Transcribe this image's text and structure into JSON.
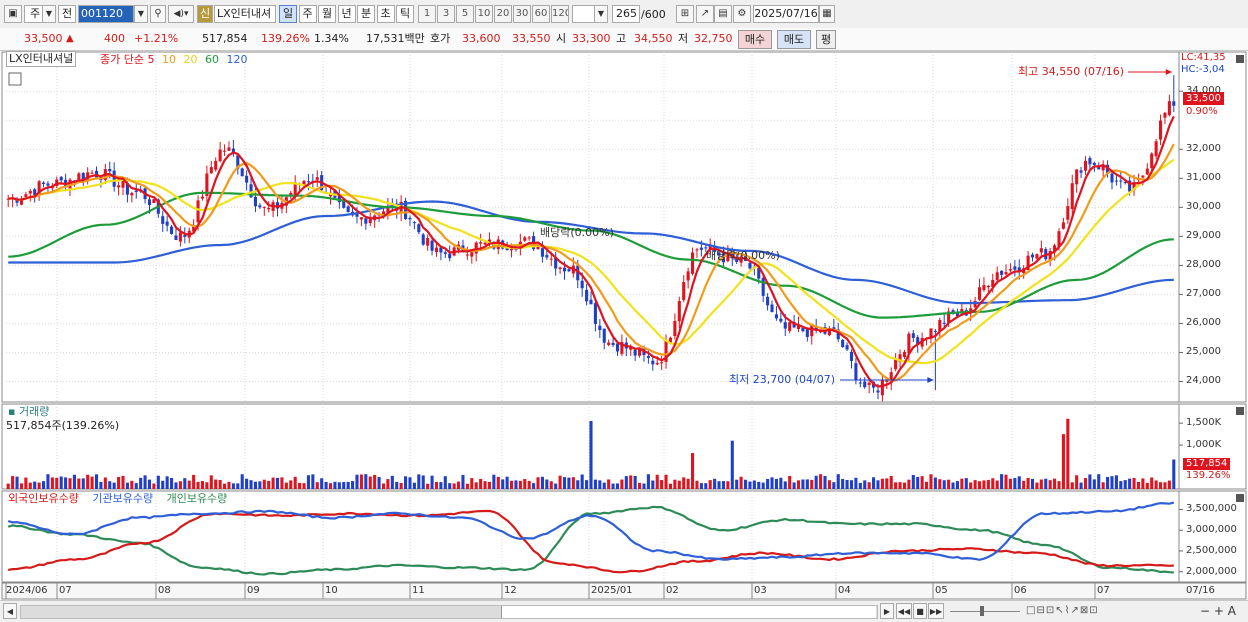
{
  "toolbar": {
    "market_label": "주",
    "prev_label": "전",
    "code_value": "001120",
    "new_badge": "신",
    "stock_name": "LX인터내셔",
    "periods": [
      "일",
      "주",
      "월",
      "년",
      "분",
      "초",
      "틱"
    ],
    "active_period": "일",
    "intervals": [
      "1",
      "3",
      "5",
      "10",
      "20",
      "30",
      "60",
      "120"
    ],
    "count_value": "265",
    "count_total": "/600",
    "date_value": "2025/07/16"
  },
  "quote": {
    "price": "33,500",
    "change_arrow": "▲",
    "change": "400",
    "change_pct": "+1.21%",
    "volume": "517,854",
    "volume_ratio": "139.26%",
    "turnover_pct": "1.34%",
    "trade_value": "17,531백만",
    "ask_label": "호가",
    "ask": "33,600",
    "bid": "33,550",
    "open_label": "시",
    "open": "33,300",
    "high_label": "고",
    "high": "34,550",
    "low_label": "저",
    "low": "32,750",
    "buy_label": "매수",
    "sell_label": "매도",
    "eval_label": "평"
  },
  "price_pane": {
    "name_label": "LX인터내셔널",
    "ma_label": "종가 단순",
    "ma_periods": [
      "5",
      "10",
      "20",
      "60",
      "120"
    ],
    "ma_colors": {
      "5": "#e0141e",
      "10": "#f29b1a",
      "20": "#f2e21a",
      "60": "#1f9c3a",
      "120": "#2e5fd6"
    },
    "lc_label": "LC:41,35",
    "hc_label": "HC:-3,04",
    "high_note": "최고 34,550 (07/16)",
    "low_note": "최저 23,700 (04/07)",
    "div_note_1": "배당락(0.00%)",
    "div_note_2": "배당락(0.00%)",
    "last_price": "33,500",
    "last_pct": "0.90%",
    "y_ticks": [
      "34,000",
      "33,000",
      "32,000",
      "31,000",
      "30,000",
      "29,000",
      "28,000",
      "27,000",
      "26,000",
      "25,000",
      "24,000"
    ]
  },
  "volume_pane": {
    "title": "거래량",
    "value_label": "517,854주(139.26%)",
    "y_ticks": [
      "1,500K",
      "1,000K",
      "500K"
    ],
    "last": "517,854",
    "last_pct": "139.26%"
  },
  "holdings_pane": {
    "foreign_label": "외국인보유수량",
    "inst_label": "기관보유수량",
    "retail_label": "개인보유수량",
    "y_ticks": [
      "3,500,000",
      "3,000,000",
      "2,500,000",
      "2,000,000"
    ]
  },
  "x_axis": {
    "labels": [
      "2024/06",
      "07",
      "08",
      "09",
      "10",
      "11",
      "12",
      "2025/01",
      "02",
      "03",
      "04",
      "05",
      "06",
      "07"
    ],
    "right_label": "07/16"
  },
  "chart_data": {
    "type": "line",
    "title": "",
    "ylim": [
      23500,
      34800
    ],
    "grid": true,
    "key_prices": {
      "high": 34550,
      "high_date": "07/16",
      "low": 23700,
      "low_date": "04/07",
      "last": 33500
    },
    "price_anchors": [
      {
        "x": "2024/06",
        "y": 30300
      },
      {
        "x": "07",
        "y": 30800
      },
      {
        "x": "07-mid",
        "y": 31200
      },
      {
        "x": "08",
        "y": 30500
      },
      {
        "x": "08-mid",
        "y": 29000
      },
      {
        "x": "09",
        "y": 32000
      },
      {
        "x": "09-mid",
        "y": 29900
      },
      {
        "x": "10",
        "y": 31000
      },
      {
        "x": "10-mid",
        "y": 29600
      },
      {
        "x": "11",
        "y": 30000
      },
      {
        "x": "11-mid",
        "y": 28400
      },
      {
        "x": "12",
        "y": 28700
      },
      {
        "x": "12-mid",
        "y": 28800
      },
      {
        "x": "2025/01",
        "y": 27900
      },
      {
        "x": "01-mid",
        "y": 25300
      },
      {
        "x": "02",
        "y": 24700
      },
      {
        "x": "02-mid",
        "y": 28600
      },
      {
        "x": "03",
        "y": 28100
      },
      {
        "x": "03-mid",
        "y": 25800
      },
      {
        "x": "04",
        "y": 25700
      },
      {
        "x": "04-low",
        "y": 23700
      },
      {
        "x": "04-mid",
        "y": 25500
      },
      {
        "x": "05",
        "y": 26300
      },
      {
        "x": "05-mid",
        "y": 27800
      },
      {
        "x": "06",
        "y": 28400
      },
      {
        "x": "06-mid",
        "y": 31600
      },
      {
        "x": "07",
        "y": 30600
      },
      {
        "x": "07/16",
        "y": 33500
      }
    ],
    "ma60_anchors": [
      28300,
      29400,
      30500,
      30400,
      30000,
      29700,
      29200,
      28200,
      27300,
      26200,
      26400,
      27500,
      28900
    ],
    "ma120_anchors": [
      28100,
      28100,
      28700,
      29700,
      30200,
      29500,
      29100,
      28500,
      27500,
      26700,
      26800,
      27500
    ],
    "volume_spikes_k": {
      "2025/01": 1550,
      "06-mid": 1600,
      "07/16": 517
    }
  }
}
